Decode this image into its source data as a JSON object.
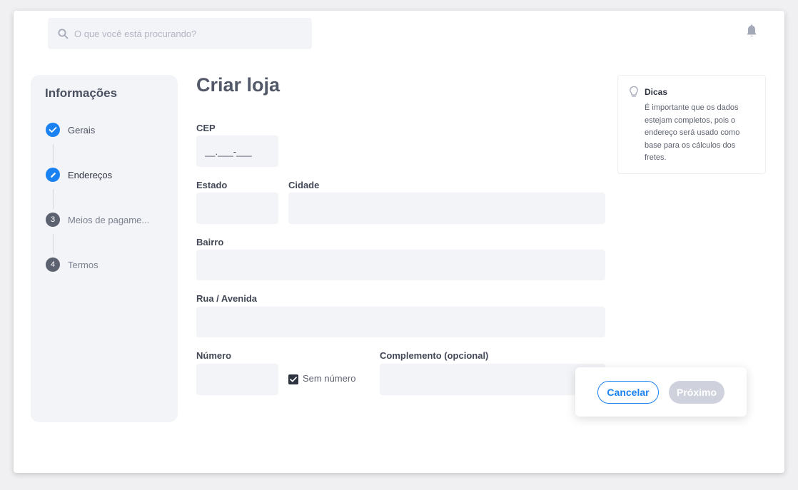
{
  "search": {
    "placeholder": "O que você está procurando?"
  },
  "sidebar": {
    "title": "Informações",
    "steps": [
      {
        "label": "Gerais",
        "marker": "✓",
        "status": "done"
      },
      {
        "label": "Endereços",
        "marker": "✎",
        "status": "current"
      },
      {
        "label": "Meios de pagame...",
        "marker": "3",
        "status": "todo"
      },
      {
        "label": "Termos",
        "marker": "4",
        "status": "todo"
      }
    ]
  },
  "form": {
    "title": "Criar loja",
    "cep": {
      "label": "CEP",
      "placeholder": "__.___-___"
    },
    "estado": {
      "label": "Estado",
      "value": ""
    },
    "cidade": {
      "label": "Cidade",
      "value": ""
    },
    "bairro": {
      "label": "Bairro",
      "value": ""
    },
    "rua": {
      "label": "Rua / Avenida",
      "value": ""
    },
    "numero": {
      "label": "Número",
      "value": ""
    },
    "sem_numero": {
      "label": "Sem número",
      "checked": true
    },
    "complemento": {
      "label": "Complemento (opcional)",
      "value": ""
    }
  },
  "tips": {
    "title": "Dicas",
    "text": "É importante que os dados estejam completos, pois o endereço será usado como base para os cálculos dos fretes."
  },
  "actions": {
    "cancel_label": "Cancelar",
    "next_label": "Próximo"
  },
  "colors": {
    "accent": "#1a82f0",
    "field_bg": "#f3f4f7",
    "disabled_button": "#cfd2dd",
    "step_inactive": "#5d6270"
  },
  "icons": {
    "search": "search-icon",
    "bell": "bell-icon",
    "lightbulb": "lightbulb-icon",
    "check": "check-icon",
    "pencil": "pencil-icon"
  }
}
